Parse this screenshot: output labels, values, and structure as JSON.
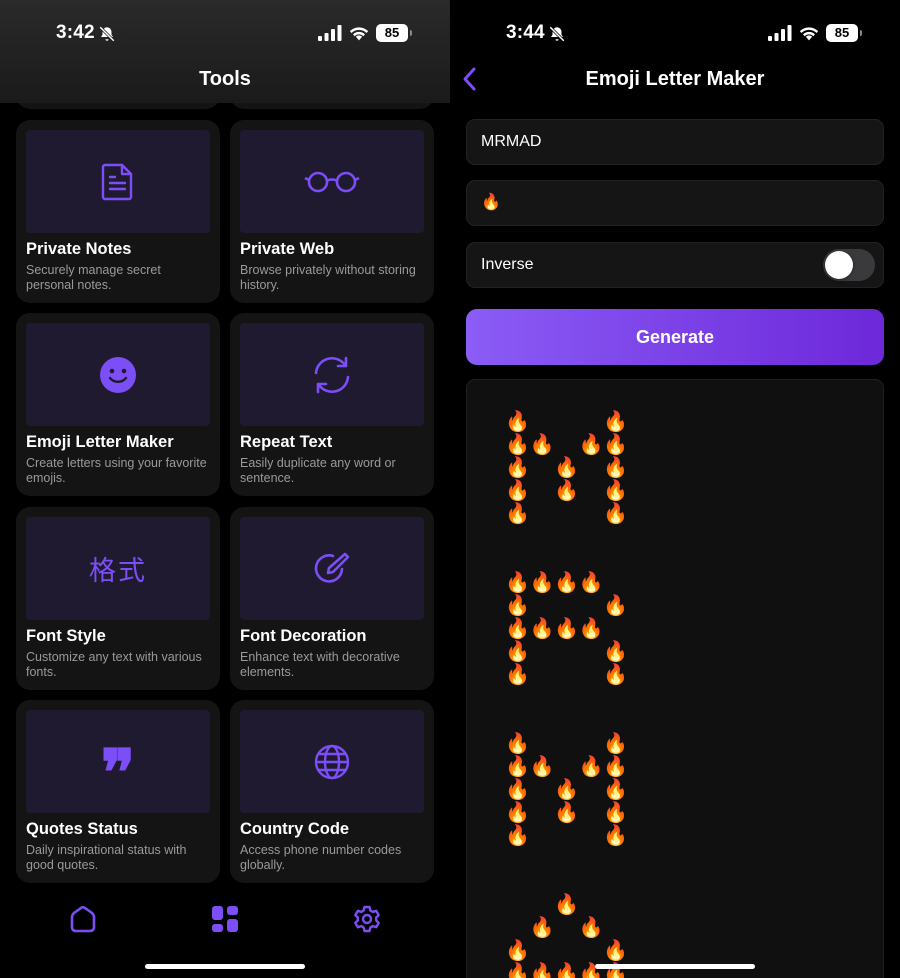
{
  "colors": {
    "accent": "#7c4ef5",
    "card_bg": "#141414",
    "preview_bg": "#201a31",
    "page_bg": "#000000"
  },
  "left": {
    "status": {
      "time": "3:42",
      "battery": "85"
    },
    "title": "Tools",
    "cards": [
      {
        "title": "Private Notes",
        "desc": "Securely manage secret personal notes.",
        "icon": "document-icon"
      },
      {
        "title": "Private Web",
        "desc": "Browse privately without storing history.",
        "icon": "glasses-icon"
      },
      {
        "title": "Emoji Letter Maker",
        "desc": "Create letters using your favorite emojis.",
        "icon": "smiley-icon"
      },
      {
        "title": "Repeat Text",
        "desc": "Easily duplicate any word or sentence.",
        "icon": "repeat-icon"
      },
      {
        "title": "Font Style",
        "desc": "Customize any text with various fonts.",
        "icon": "font-style-glyph",
        "glyph": "格式"
      },
      {
        "title": "Font Decoration",
        "desc": "Enhance text with decorative elements.",
        "icon": "compose-icon"
      },
      {
        "title": "Quotes Status",
        "desc": "Daily inspirational status with good quotes.",
        "icon": "quote-icon",
        "glyph": "❞"
      },
      {
        "title": "Country Code",
        "desc": "Access phone number codes globally.",
        "icon": "globe-icon"
      }
    ],
    "tabs": [
      "home-icon",
      "grid-icon",
      "gear-icon"
    ]
  },
  "right": {
    "status": {
      "time": "3:44",
      "battery": "85"
    },
    "title": "Emoji Letter Maker",
    "text_input": "MRMAD",
    "emoji_input": "🔥",
    "inverse_label": "Inverse",
    "inverse_on": false,
    "generate_label": "Generate",
    "emoji": "🔥",
    "output_letters": [
      "M",
      "R",
      "M",
      "A"
    ]
  }
}
